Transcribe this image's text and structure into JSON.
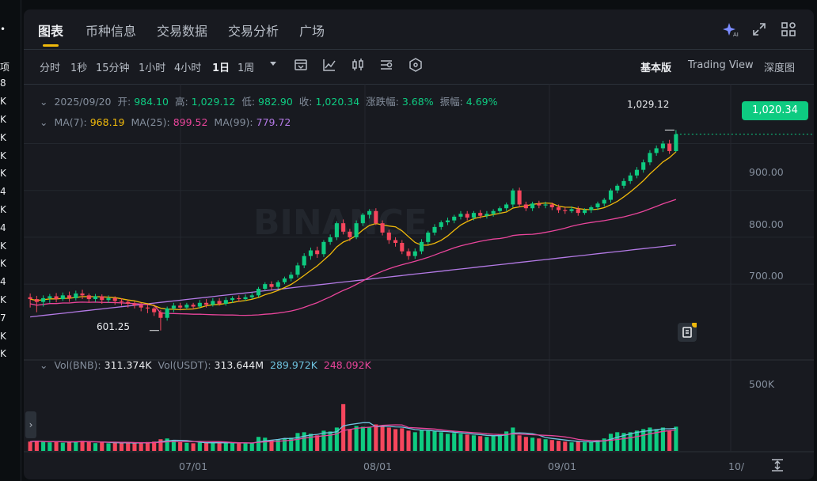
{
  "left_strip": [
    "•",
    "",
    "项",
    "8",
    "K",
    "K",
    "K",
    "K",
    "K",
    "4",
    "K",
    "4",
    "K",
    "K",
    "4",
    "K",
    "7",
    "K",
    "K"
  ],
  "tabs": [
    "图表",
    "币种信息",
    "交易数据",
    "交易分析",
    "广场"
  ],
  "active_tab": 0,
  "header_icons": [
    "ai-sparkle-icon",
    "expand-icon",
    "layout-grid-icon"
  ],
  "toolbar": {
    "intervals": [
      "分时",
      "1秒",
      "15分钟",
      "1小时",
      "4小时",
      "1日",
      "1周"
    ],
    "active_interval": "1日",
    "tool_icons": [
      "more-dropdown-icon",
      "indicator-icon",
      "drawing-icon",
      "candle-type-icon",
      "settings-icon",
      "hexagon-icon"
    ],
    "views": [
      "基本版",
      "Trading View",
      "深度图"
    ],
    "active_view": "基本版"
  },
  "ohlc": {
    "date": "2025/09/20",
    "open_label": "开:",
    "open": "984.10",
    "high_label": "高:",
    "high": "1,029.12",
    "low_label": "低:",
    "low": "982.90",
    "close_label": "收:",
    "close": "1,020.34",
    "change_label": "涨跌幅:",
    "change": "3.68%",
    "amp_label": "振幅:",
    "amp": "4.69%"
  },
  "ma": {
    "ma7_label": "MA(7):",
    "ma7": "968.19",
    "ma25_label": "MA(25):",
    "ma25": "899.52",
    "ma99_label": "MA(99):",
    "ma99": "779.72"
  },
  "vol": {
    "vol_bnb_label": "Vol(BNB):",
    "vol_bnb": "311.374K",
    "vol_usdt_label": "Vol(USDT):",
    "vol_usdt": "313.644M",
    "ma5": "289.972K",
    "ma10": "248.092K"
  },
  "watermark": "BINANCE",
  "last_price": "1,020.34",
  "high_marker": "1,029.12",
  "low_marker": "601.25",
  "colors": {
    "up": "#0ecb81",
    "down": "#f6465d",
    "ma7": "#f0b90b",
    "ma25": "#e9459b",
    "ma99": "#b47ae6",
    "volma5": "#6fc3df",
    "volma10": "#e9459b"
  },
  "chart_data": {
    "type": "candlestick",
    "y_ticks": [
      "900.00",
      "800.00",
      "700.00"
    ],
    "volume_ticks": [
      "500K"
    ],
    "x_ticks": [
      "07/01",
      "08/01",
      "09/01",
      "10/"
    ],
    "ylim": [
      560,
      1060
    ],
    "volume_ylim": [
      0,
      700
    ],
    "candles": [
      [
        672,
        668,
        680,
        650,
        120
      ],
      [
        668,
        662,
        675,
        640,
        130
      ],
      [
        662,
        670,
        676,
        652,
        115
      ],
      [
        670,
        674,
        679,
        660,
        110
      ],
      [
        674,
        668,
        681,
        661,
        125
      ],
      [
        668,
        676,
        682,
        664,
        105
      ],
      [
        676,
        670,
        684,
        662,
        118
      ],
      [
        670,
        680,
        686,
        665,
        122
      ],
      [
        680,
        676,
        688,
        668,
        130
      ],
      [
        676,
        668,
        680,
        660,
        112
      ],
      [
        668,
        674,
        679,
        662,
        100
      ],
      [
        674,
        666,
        678,
        658,
        108
      ],
      [
        666,
        670,
        676,
        660,
        98
      ],
      [
        670,
        664,
        674,
        656,
        110
      ],
      [
        664,
        662,
        670,
        654,
        104
      ],
      [
        662,
        658,
        666,
        650,
        100
      ],
      [
        658,
        655,
        663,
        648,
        96
      ],
      [
        655,
        650,
        660,
        642,
        110
      ],
      [
        650,
        648,
        656,
        638,
        114
      ],
      [
        648,
        640,
        652,
        632,
        120
      ],
      [
        640,
        628,
        645,
        601,
        150
      ],
      [
        628,
        648,
        652,
        622,
        160
      ],
      [
        648,
        654,
        660,
        640,
        140
      ],
      [
        654,
        650,
        660,
        644,
        112
      ],
      [
        650,
        656,
        660,
        646,
        104
      ],
      [
        656,
        652,
        660,
        646,
        98
      ],
      [
        652,
        660,
        666,
        648,
        106
      ],
      [
        660,
        656,
        668,
        650,
        102
      ],
      [
        656,
        664,
        670,
        652,
        110
      ],
      [
        664,
        658,
        670,
        654,
        104
      ],
      [
        658,
        666,
        672,
        654,
        108
      ],
      [
        666,
        670,
        674,
        660,
        100
      ],
      [
        670,
        668,
        676,
        662,
        96
      ],
      [
        668,
        672,
        678,
        664,
        102
      ],
      [
        672,
        676,
        682,
        668,
        98
      ],
      [
        676,
        690,
        694,
        672,
        180
      ],
      [
        690,
        700,
        704,
        686,
        170
      ],
      [
        700,
        694,
        706,
        688,
        140
      ],
      [
        694,
        704,
        708,
        690,
        150
      ],
      [
        704,
        712,
        716,
        700,
        160
      ],
      [
        712,
        720,
        726,
        706,
        170
      ],
      [
        720,
        740,
        746,
        714,
        230
      ],
      [
        740,
        760,
        766,
        734,
        240
      ],
      [
        760,
        772,
        778,
        752,
        220
      ],
      [
        772,
        764,
        780,
        756,
        200
      ],
      [
        764,
        790,
        794,
        758,
        260
      ],
      [
        790,
        800,
        806,
        784,
        250
      ],
      [
        800,
        830,
        834,
        794,
        300
      ],
      [
        830,
        812,
        838,
        806,
        600
      ],
      [
        812,
        800,
        818,
        792,
        280
      ],
      [
        800,
        830,
        836,
        796,
        320
      ],
      [
        830,
        848,
        852,
        824,
        310
      ],
      [
        848,
        856,
        860,
        840,
        300
      ],
      [
        856,
        830,
        862,
        826,
        340
      ],
      [
        830,
        810,
        836,
        804,
        320
      ],
      [
        810,
        794,
        816,
        786,
        300
      ],
      [
        794,
        788,
        800,
        780,
        280
      ],
      [
        788,
        770,
        794,
        764,
        290
      ],
      [
        770,
        760,
        776,
        752,
        260
      ],
      [
        760,
        770,
        776,
        754,
        240
      ],
      [
        770,
        790,
        796,
        764,
        270
      ],
      [
        790,
        810,
        814,
        784,
        260
      ],
      [
        810,
        822,
        828,
        804,
        250
      ],
      [
        822,
        832,
        836,
        816,
        240
      ],
      [
        832,
        836,
        842,
        826,
        220
      ],
      [
        836,
        844,
        848,
        830,
        230
      ],
      [
        844,
        850,
        856,
        838,
        220
      ],
      [
        850,
        842,
        856,
        836,
        210
      ],
      [
        842,
        852,
        856,
        836,
        200
      ],
      [
        852,
        846,
        858,
        840,
        190
      ],
      [
        846,
        850,
        856,
        840,
        180
      ],
      [
        850,
        856,
        860,
        844,
        200
      ],
      [
        856,
        862,
        866,
        850,
        210
      ],
      [
        862,
        870,
        874,
        856,
        250
      ],
      [
        870,
        900,
        904,
        864,
        300
      ],
      [
        900,
        870,
        906,
        864,
        200
      ],
      [
        870,
        862,
        876,
        856,
        180
      ],
      [
        862,
        872,
        876,
        856,
        170
      ],
      [
        872,
        868,
        878,
        862,
        160
      ],
      [
        868,
        870,
        876,
        862,
        150
      ],
      [
        870,
        864,
        874,
        858,
        140
      ],
      [
        864,
        858,
        870,
        852,
        130
      ],
      [
        858,
        856,
        864,
        850,
        120
      ],
      [
        856,
        860,
        866,
        852,
        110
      ],
      [
        860,
        852,
        866,
        846,
        120
      ],
      [
        852,
        858,
        862,
        848,
        110
      ],
      [
        858,
        864,
        868,
        852,
        120
      ],
      [
        864,
        872,
        876,
        858,
        140
      ],
      [
        872,
        880,
        884,
        866,
        160
      ],
      [
        880,
        900,
        904,
        874,
        220
      ],
      [
        900,
        910,
        914,
        894,
        240
      ],
      [
        910,
        920,
        926,
        904,
        230
      ],
      [
        920,
        932,
        938,
        914,
        240
      ],
      [
        932,
        944,
        950,
        926,
        260
      ],
      [
        944,
        960,
        966,
        938,
        280
      ],
      [
        960,
        980,
        986,
        954,
        300
      ],
      [
        980,
        990,
        996,
        974,
        280
      ],
      [
        990,
        1000,
        1006,
        982,
        300
      ],
      [
        1000,
        984,
        1008,
        978,
        260
      ],
      [
        984,
        1020,
        1029,
        982,
        311
      ]
    ]
  }
}
